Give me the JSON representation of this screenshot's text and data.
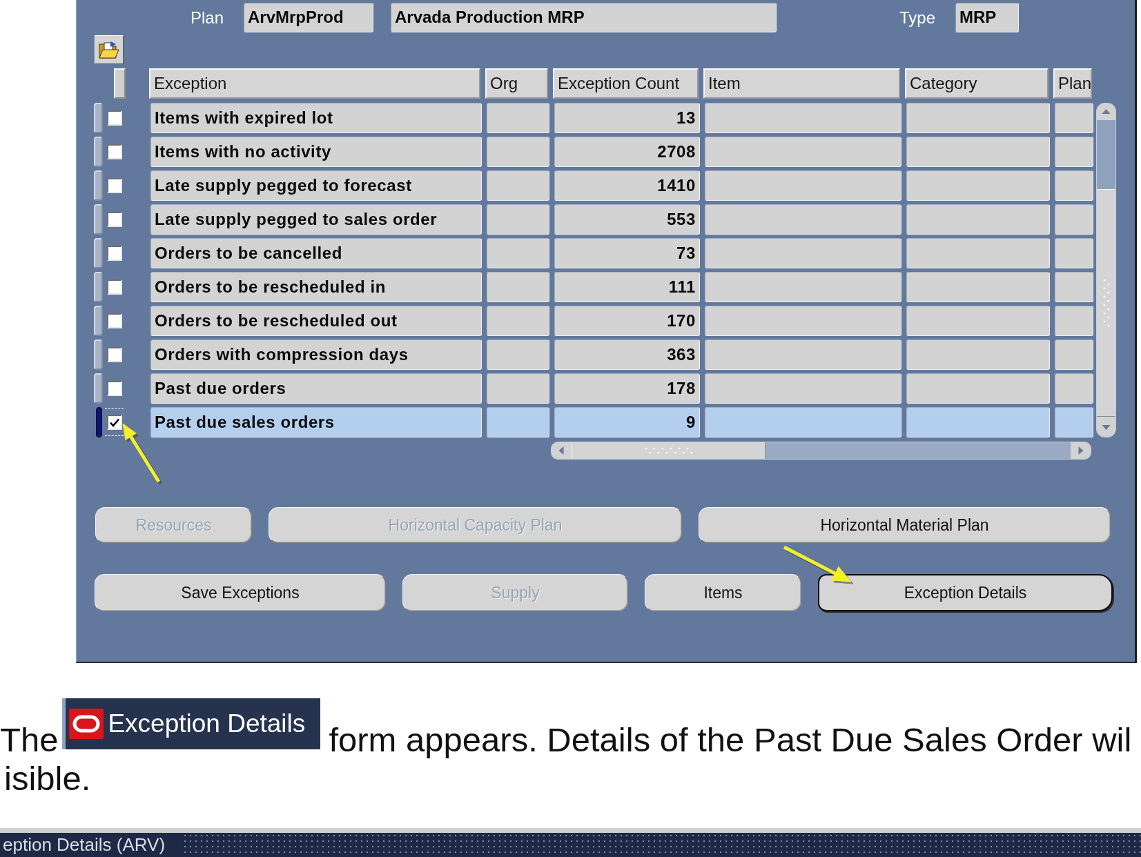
{
  "plan_header": {
    "plan_label": "Plan",
    "plan_code": "ArvMrpProd",
    "plan_name": "Arvada Production MRP",
    "type_label": "Type",
    "plan_type": "MRP"
  },
  "table": {
    "columns": [
      "Exception",
      "Org",
      "Exception Count",
      "Item",
      "Category",
      "Plan"
    ],
    "rows": [
      {
        "exception": "Items with expired lot",
        "count": "13",
        "checked": false,
        "selected": false
      },
      {
        "exception": "Items with no activity",
        "count": "2708",
        "checked": false,
        "selected": false
      },
      {
        "exception": "Late supply pegged to forecast",
        "count": "1410",
        "checked": false,
        "selected": false
      },
      {
        "exception": "Late supply pegged to sales order",
        "count": "553",
        "checked": false,
        "selected": false
      },
      {
        "exception": "Orders to be cancelled",
        "count": "73",
        "checked": false,
        "selected": false
      },
      {
        "exception": "Orders to be rescheduled in",
        "count": "111",
        "checked": false,
        "selected": false
      },
      {
        "exception": "Orders to be rescheduled out",
        "count": "170",
        "checked": false,
        "selected": false
      },
      {
        "exception": "Orders with compression days",
        "count": "363",
        "checked": false,
        "selected": false
      },
      {
        "exception": "Past due orders",
        "count": "178",
        "checked": false,
        "selected": false
      },
      {
        "exception": "Past due sales orders",
        "count": "9",
        "checked": true,
        "selected": true
      }
    ]
  },
  "button_rows": [
    {
      "buttons": [
        {
          "label": "Resources",
          "disabled": true,
          "focused": false
        },
        {
          "label": "Horizontal Capacity Plan",
          "disabled": true,
          "focused": false
        },
        {
          "label": "Horizontal Material Plan",
          "disabled": false,
          "focused": false
        }
      ]
    },
    {
      "buttons": [
        {
          "label": "Save Exceptions",
          "disabled": false,
          "focused": false
        },
        {
          "label": "Supply",
          "disabled": true,
          "focused": false
        },
        {
          "label": "Items",
          "disabled": false,
          "focused": false
        },
        {
          "label": "Exception Details",
          "disabled": false,
          "focused": true
        }
      ]
    }
  ],
  "caption": {
    "lead": "The",
    "badge_title": "Exception Details",
    "text": "form appears. Details of the Past Due Sales Order wil",
    "continuation": "isible."
  },
  "next_window": {
    "title": "eption Details (ARV)"
  }
}
